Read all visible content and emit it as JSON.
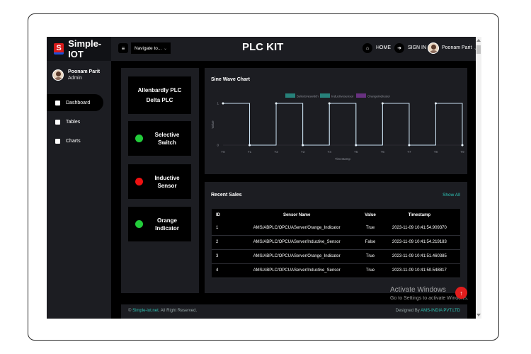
{
  "brand": {
    "name": "Simple-IOT",
    "logo_letter": "S"
  },
  "profile": {
    "name": "Poonam Parit",
    "role": "Admin"
  },
  "sidebar": {
    "items": [
      {
        "label": "Dashboard",
        "icon": "dashboard-icon",
        "active": true
      },
      {
        "label": "Tables",
        "icon": "table-icon",
        "active": false
      },
      {
        "label": "Charts",
        "icon": "chart-icon",
        "active": false
      }
    ]
  },
  "topbar": {
    "menu_icon": "≡",
    "navigate_label": "Navigate to...",
    "title": "PLC KIT",
    "home_label": "HOME",
    "signin_label": "SIGN IN",
    "user_name": "Poonam Parit"
  },
  "devices": {
    "plc_lines": [
      "Allenbardly PLC",
      "Delta PLC"
    ],
    "items": [
      {
        "lines": [
          "Selective",
          "Switch"
        ],
        "color": "#22cc3a"
      },
      {
        "lines": [
          "Inductive",
          "Sensor"
        ],
        "color": "#ee1111"
      },
      {
        "lines": [
          "Orange",
          "Indicator"
        ],
        "color": "#22cc3a"
      }
    ]
  },
  "chart": {
    "title": "Sine Wave Chart",
    "legend": [
      "Selectiveswitch",
      "Inductivesensor",
      "Orangeindicator"
    ],
    "legend_colors": [
      "#2ec4b6",
      "#2ec4b6",
      "#9b3fbf"
    ],
    "xlabel": "Timestamp",
    "ylabel": "Value",
    "ytick_top": "1",
    "ytick_bottom": "0"
  },
  "chart_data": {
    "type": "line",
    "title": "Sine Wave Chart",
    "xlabel": "Timestamp",
    "ylabel": "Value",
    "categories": [
      "T0",
      "T1",
      "T2",
      "T3",
      "T4",
      "T5",
      "T6",
      "T7",
      "T8",
      "T9"
    ],
    "ylim": [
      0,
      1
    ],
    "series": [
      {
        "name": "Selectiveswitch",
        "values": [
          1,
          0,
          1,
          0,
          1,
          0,
          1,
          0,
          1,
          0
        ]
      },
      {
        "name": "Inductivesensor",
        "values": [
          1,
          0,
          1,
          0,
          1,
          0,
          1,
          0,
          1,
          0
        ]
      },
      {
        "name": "Orangeindicator",
        "values": [
          1,
          0,
          1,
          0,
          1,
          0,
          1,
          0,
          1,
          0
        ]
      }
    ],
    "grid": false,
    "legend": "top"
  },
  "sales": {
    "title": "Recent Sales",
    "show_all": "Show All",
    "columns": [
      "ID",
      "Sensor Name",
      "Value",
      "Timestamp"
    ],
    "rows": [
      [
        "1",
        "AMS/ABPLC/OPCUAServer/Orange_Indicator",
        "True",
        "2023-11-09 10:41:54.909370"
      ],
      [
        "2",
        "AMS/ABPLC/OPCUAServer/Inductive_Sensor",
        "False",
        "2023-11-09 10:41:54.219183"
      ],
      [
        "3",
        "AMS/ABPLC/OPCUAServer/Orange_Indicator",
        "True",
        "2023-11-09 10:41:51.460385"
      ],
      [
        "4",
        "AMS/ABPLC/OPCUAServer/Inductive_Sensor",
        "True",
        "2023-11-09 10:41:50.548817"
      ]
    ]
  },
  "footer": {
    "copyright_link": "Simple-iot.net",
    "copyright_rest": ". All Right Reserved.",
    "designed_prefix": "Designed By ",
    "designed_link": "AMS-INDIA PVT.LTD"
  },
  "watermark": {
    "line1": "Activate Windows",
    "line2": "Go to Settings to activate Windows."
  },
  "colors": {
    "accent": "#2ec4b6",
    "panel": "#1c1d22",
    "background": "#000000",
    "fab": "#e11d1d"
  }
}
